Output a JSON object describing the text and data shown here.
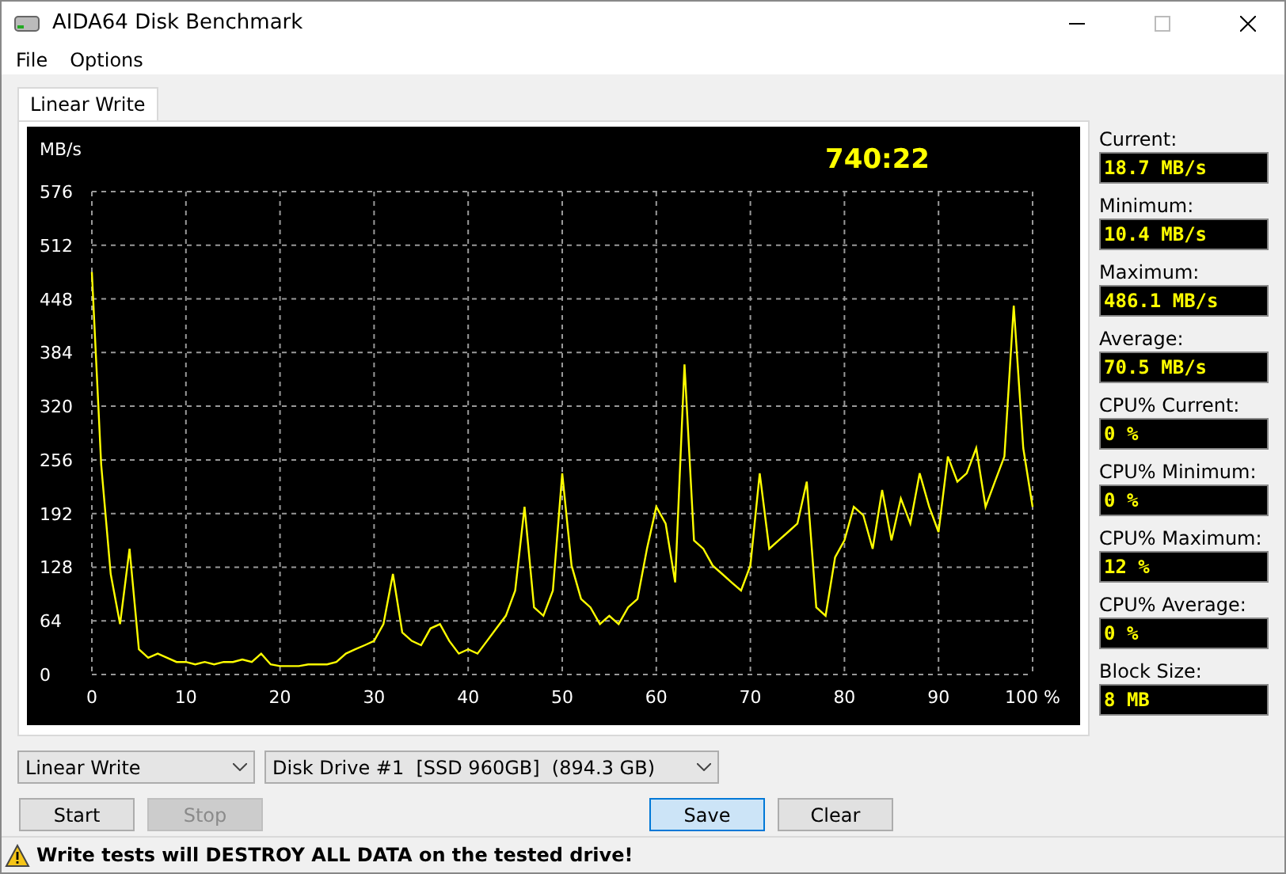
{
  "window": {
    "title": "AIDA64 Disk Benchmark"
  },
  "menu": [
    "File",
    "Options"
  ],
  "tabs": [
    {
      "label": "Linear Write",
      "selected": true
    }
  ],
  "chart": {
    "elapsed": "740:22",
    "chart_data": {
      "type": "line",
      "grid": true,
      "ylabel": "MB/s",
      "xlim": [
        0,
        100
      ],
      "ylim": [
        0,
        576
      ],
      "xticks": [
        0,
        10,
        20,
        30,
        40,
        50,
        60,
        70,
        80,
        90,
        {
          "value": 100,
          "label": "100 %"
        }
      ],
      "yticks": [
        0,
        64,
        128,
        192,
        256,
        320,
        384,
        448,
        512,
        576
      ],
      "x": [
        0,
        1,
        2,
        3,
        4,
        5,
        6,
        7,
        8,
        9,
        10,
        11,
        12,
        13,
        14,
        15,
        16,
        17,
        18,
        19,
        20,
        21,
        22,
        23,
        24,
        25,
        26,
        27,
        28,
        29,
        30,
        31,
        32,
        33,
        34,
        35,
        36,
        37,
        38,
        39,
        40,
        41,
        42,
        43,
        44,
        45,
        46,
        47,
        48,
        49,
        50,
        51,
        52,
        53,
        54,
        55,
        56,
        57,
        58,
        59,
        60,
        61,
        62,
        63,
        64,
        65,
        66,
        67,
        68,
        69,
        70,
        71,
        72,
        73,
        74,
        75,
        76,
        77,
        78,
        79,
        80,
        81,
        82,
        83,
        84,
        85,
        86,
        87,
        88,
        89,
        90,
        91,
        92,
        93,
        94,
        95,
        96,
        97,
        98,
        99,
        100
      ],
      "series": [
        {
          "color": "#ffff00",
          "values": [
            480,
            250,
            120,
            60,
            150,
            30,
            20,
            25,
            20,
            15,
            15,
            12,
            15,
            12,
            15,
            15,
            18,
            15,
            25,
            12,
            10,
            10,
            10,
            12,
            12,
            12,
            15,
            25,
            30,
            35,
            40,
            60,
            120,
            50,
            40,
            35,
            55,
            60,
            40,
            25,
            30,
            25,
            40,
            55,
            70,
            100,
            200,
            80,
            70,
            100,
            240,
            130,
            90,
            80,
            60,
            70,
            60,
            80,
            90,
            150,
            200,
            180,
            110,
            370,
            160,
            150,
            130,
            120,
            110,
            100,
            130,
            240,
            150,
            160,
            170,
            180,
            230,
            80,
            70,
            140,
            160,
            200,
            190,
            150,
            220,
            160,
            210,
            180,
            240,
            200,
            170,
            260,
            230,
            240,
            270,
            200,
            230,
            260,
            440,
            270,
            200
          ]
        }
      ]
    }
  },
  "stats": [
    {
      "label": "Current:",
      "value": "18.7 MB/s"
    },
    {
      "label": "Minimum:",
      "value": "10.4 MB/s"
    },
    {
      "label": "Maximum:",
      "value": "486.1 MB/s"
    },
    {
      "label": "Average:",
      "value": "70.5 MB/s"
    },
    {
      "label": "CPU% Current:",
      "value": "0 %"
    },
    {
      "label": "CPU% Minimum:",
      "value": "0 %"
    },
    {
      "label": "CPU% Maximum:",
      "value": "12 %"
    },
    {
      "label": "CPU% Average:",
      "value": "0 %"
    },
    {
      "label": "Block Size:",
      "value": "8 MB"
    }
  ],
  "test_select": {
    "value": "Linear Write"
  },
  "drive_select": {
    "value": "Disk Drive #1  [SSD 960GB]  (894.3 GB)"
  },
  "buttons": [
    {
      "label": "Start",
      "disabled": false,
      "focused": false
    },
    {
      "label": "Stop",
      "disabled": true,
      "focused": false
    },
    {
      "label": "Save",
      "disabled": false,
      "focused": true
    },
    {
      "label": "Clear",
      "disabled": false,
      "focused": false
    }
  ],
  "status_bar": {
    "warning": "Write tests will DESTROY ALL DATA on the tested drive!"
  }
}
